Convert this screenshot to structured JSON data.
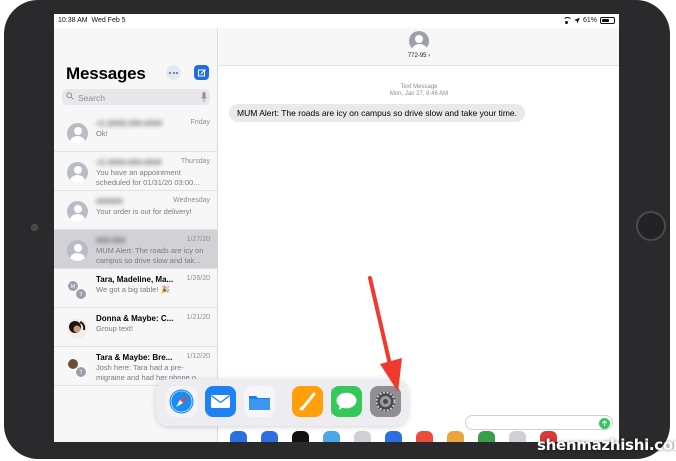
{
  "status_bar": {
    "time": "10:38 AM",
    "date": "Wed Feb 5",
    "battery": "61%",
    "battery_level": 0.61
  },
  "sidebar": {
    "title": "Messages",
    "search_placeholder": "Search",
    "conversations": [
      {
        "name": "+1 (###) ###-####",
        "date": "Friday",
        "preview": "Ok!",
        "blurred": true,
        "avatar": "person"
      },
      {
        "name": "+1 ####-###-####",
        "date": "Thursday",
        "preview": "You have an appointment scheduled for 01/31/20 03:00...",
        "blurred": true,
        "avatar": "person"
      },
      {
        "name": "######",
        "date": "Wednesday",
        "preview": "Your order is out for delivery!",
        "blurred": true,
        "avatar": "person"
      },
      {
        "name": "###-###",
        "date": "1/27/20",
        "preview": "MUM Alert: The roads are icy on campus so drive slow and tak...",
        "blurred": true,
        "avatar": "person",
        "selected": true
      },
      {
        "name": "Tara, Madeline, Ma...",
        "date": "1/26/20",
        "preview": "We got a big table! 🎉",
        "blurred": false,
        "avatar": "group",
        "initials": [
          "M",
          "T"
        ]
      },
      {
        "name": "Donna & Maybe: C...",
        "date": "1/21/20",
        "preview": "Group text!",
        "blurred": false,
        "avatar": "photo"
      },
      {
        "name": "Tara & Maybe: Bre...",
        "date": "1/12/20",
        "preview": "Josh here: Tara had a pre-migraine and had her phone o...",
        "blurred": false,
        "avatar": "group-photo",
        "initials": [
          "",
          "T"
        ]
      }
    ]
  },
  "conversation": {
    "contact": "772-95 ›",
    "meta_type": "Text Message",
    "meta_date": "Mon, Jan 27, 8:46 AM",
    "message": "MUM Alert: The roads are icy on campus so drive slow and take your time."
  },
  "dock": {
    "apps": [
      "Safari",
      "Mail",
      "Files",
      "Pages",
      "Messages",
      "Settings"
    ],
    "icons": [
      "safari-icon",
      "mail-icon",
      "files-icon",
      "pages-icon",
      "messages-icon",
      "settings-icon"
    ]
  },
  "annotation": {
    "arrow_color": "#f03a2e"
  },
  "watermark": "shenmazhishi.com"
}
